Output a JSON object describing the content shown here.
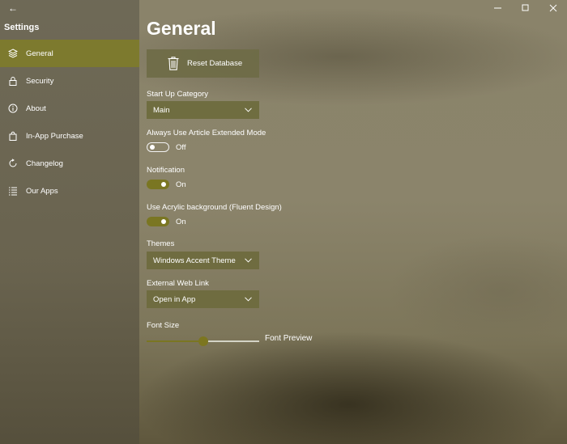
{
  "window": {
    "title": "Settings",
    "back_icon": "back-arrow-icon",
    "minimize_icon": "minimize-icon",
    "maximize_icon": "maximize-icon",
    "close_icon": "close-icon"
  },
  "sidebar": {
    "items": [
      {
        "label": "General",
        "icon": "layers-icon",
        "active": true
      },
      {
        "label": "Security",
        "icon": "lock-icon",
        "active": false
      },
      {
        "label": "About",
        "icon": "info-icon",
        "active": false
      },
      {
        "label": "In-App Purchase",
        "icon": "shopping-bag-icon",
        "active": false
      },
      {
        "label": "Changelog",
        "icon": "refresh-icon",
        "active": false
      },
      {
        "label": "Our Apps",
        "icon": "list-icon",
        "active": false
      }
    ]
  },
  "main": {
    "title": "General",
    "reset_button": {
      "label": "Reset Database",
      "icon": "trash-icon"
    },
    "startup_category": {
      "label": "Start Up Category",
      "value": "Main"
    },
    "extended_mode": {
      "label": "Always Use Article Extended Mode",
      "state": "Off",
      "on": false
    },
    "notification": {
      "label": "Notification",
      "state": "On",
      "on": true
    },
    "acrylic": {
      "label": "Use Acrylic background (Fluent Design)",
      "state": "On",
      "on": true
    },
    "themes": {
      "label": "Themes",
      "value": "Windows Accent Theme"
    },
    "external_link": {
      "label": "External Web Link",
      "value": "Open in App"
    },
    "font_size": {
      "label": "Font Size",
      "preview": "Font Preview",
      "level": 0.5
    }
  },
  "colors": {
    "accent": "#7d7a2e",
    "sidebar": "#6b6654",
    "background": "#8a836a"
  }
}
